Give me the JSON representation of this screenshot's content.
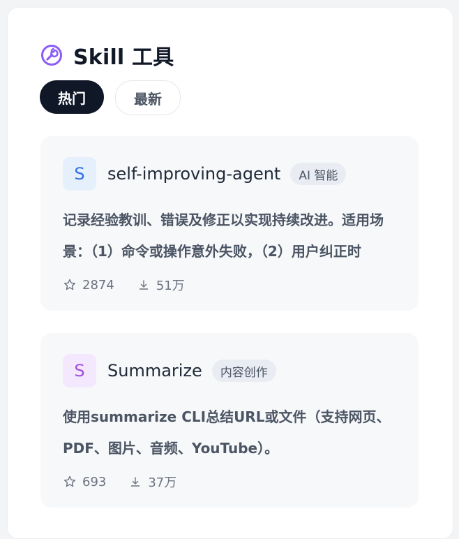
{
  "header": {
    "title": "Skill 工具",
    "icon": "wrench-circle-icon",
    "accent": "#8b5cf6"
  },
  "tabs": [
    {
      "label": "热门",
      "active": true
    },
    {
      "label": "最新",
      "active": false
    }
  ],
  "skills": [
    {
      "avatar_letter": "S",
      "avatar_color": "#2f6fe6",
      "name": "self-improving-agent",
      "tag": "AI 智能",
      "description": "记录经验教训、错误及修正以实现持续改进。适用场景：（1）命令或操作意外失败，（2）用户纠正时",
      "stars": "2874",
      "downloads": "51万"
    },
    {
      "avatar_letter": "S",
      "avatar_color": "#a24ee0",
      "name": "Summarize",
      "tag": "内容创作",
      "description": "使用summarize CLI总结URL或文件（支持网页、PDF、图片、音频、YouTube）。",
      "stars": "693",
      "downloads": "37万"
    }
  ]
}
